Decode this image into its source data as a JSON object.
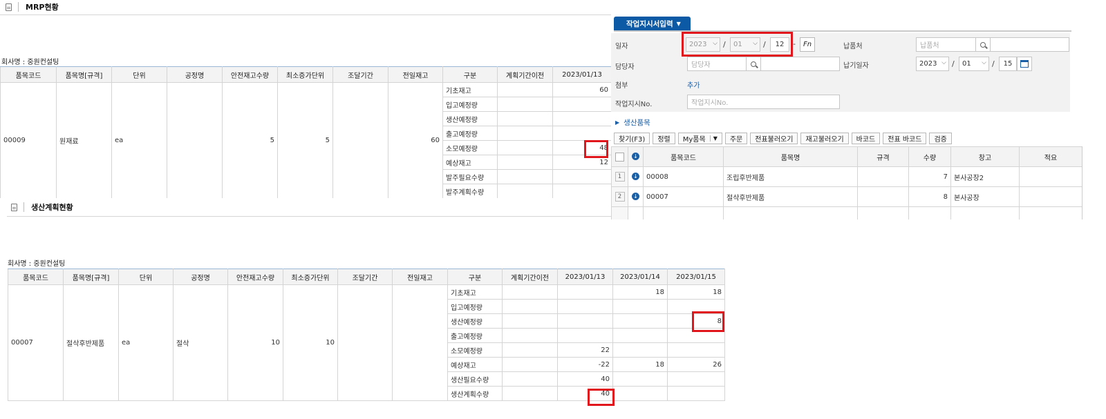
{
  "mrp_panel": {
    "title": "MRP현황",
    "company_label": "회사명 : 중원컨설팅",
    "columns": [
      "품목코드",
      "품목명[규격]",
      "단위",
      "공정명",
      "안전재고수량",
      "최소증가단위",
      "조달기간",
      "전일재고",
      "구분",
      "계획기간이전",
      "2023/01/13"
    ],
    "item": {
      "code": "00009",
      "name": "원재료",
      "unit": "ea",
      "process": "",
      "safety_stock": "5",
      "min_increment": "5",
      "lead_time": "",
      "prev_stock": "60"
    },
    "rows": [
      {
        "label": "기초재고",
        "before": "",
        "d1": "60"
      },
      {
        "label": "입고예정량",
        "before": "",
        "d1": ""
      },
      {
        "label": "생산예정량",
        "before": "",
        "d1": ""
      },
      {
        "label": "출고예정량",
        "before": "",
        "d1": ""
      },
      {
        "label": "소모예정량",
        "before": "",
        "d1": "48"
      },
      {
        "label": "예상재고",
        "before": "",
        "d1": "12"
      },
      {
        "label": "발주필요수량",
        "before": "",
        "d1": ""
      },
      {
        "label": "발주계획수량",
        "before": "",
        "d1": ""
      }
    ]
  },
  "plan_panel": {
    "title": "생산계획현황",
    "company_label": "회사명 : 중원컨설팅",
    "columns": [
      "품목코드",
      "품목명[규격]",
      "단위",
      "공정명",
      "안전재고수량",
      "최소증가단위",
      "조달기간",
      "전일재고",
      "구분",
      "계획기간이전",
      "2023/01/13",
      "2023/01/14",
      "2023/01/15"
    ],
    "item": {
      "code": "00007",
      "name": "절삭후반제품",
      "unit": "ea",
      "process": "절삭",
      "safety_stock": "10",
      "min_increment": "10",
      "lead_time": "",
      "prev_stock": ""
    },
    "rows": [
      {
        "label": "기초재고",
        "before": "",
        "d1": "",
        "d2": "18",
        "d3": "18"
      },
      {
        "label": "입고예정량",
        "before": "",
        "d1": "",
        "d2": "",
        "d3": ""
      },
      {
        "label": "생산예정량",
        "before": "",
        "d1": "",
        "d2": "",
        "d3": "8"
      },
      {
        "label": "출고예정량",
        "before": "",
        "d1": "",
        "d2": "",
        "d3": ""
      },
      {
        "label": "소모예정량",
        "before": "",
        "d1": "22",
        "d2": "",
        "d3": ""
      },
      {
        "label": "예상재고",
        "before": "",
        "d1": "-22",
        "d2": "18",
        "d3": "26"
      },
      {
        "label": "생산필요수량",
        "before": "",
        "d1": "40",
        "d2": "",
        "d3": ""
      },
      {
        "label": "생산계획수량",
        "before": "",
        "d1": "40",
        "d2": "",
        "d3": ""
      }
    ]
  },
  "work_order": {
    "tab_label": "작업지시서입력",
    "tab_caret": "▼",
    "labels": {
      "date": "일자",
      "supplier": "납품처",
      "manager": "담당자",
      "due_date": "납기일자",
      "attach": "첨부",
      "order_no": "작업지시No."
    },
    "date": {
      "year": "2023",
      "month": "01",
      "day": "12",
      "dash": "-"
    },
    "fn_label": "Fn",
    "supplier_placeholder": "납품처",
    "manager_placeholder": "담당자",
    "due": {
      "year": "2023",
      "month": "01",
      "day": "15"
    },
    "attach_link": "추가",
    "order_no_placeholder": "작업지시No.",
    "section_title": "생산품목",
    "buttons": [
      "찾기(F3)",
      "정렬",
      "My품목",
      "주문",
      "전표불러오기",
      "재고불러오기",
      "바코드",
      "전표 바코드",
      "검증"
    ],
    "grid_columns": [
      "품목코드",
      "품목명",
      "규격",
      "수량",
      "창고",
      "적요"
    ],
    "grid_rows": [
      {
        "no": "1",
        "code": "00008",
        "name": "조립후반제품",
        "spec": "",
        "qty": "7",
        "warehouse": "본사공장2",
        "memo": ""
      },
      {
        "no": "2",
        "code": "00007",
        "name": "절삭후반제품",
        "spec": "",
        "qty": "8",
        "warehouse": "본사공장",
        "memo": ""
      }
    ]
  },
  "colors": {
    "highlight": "#e0161c",
    "tab": "#0c5aa6",
    "link": "#1c5fa5"
  }
}
